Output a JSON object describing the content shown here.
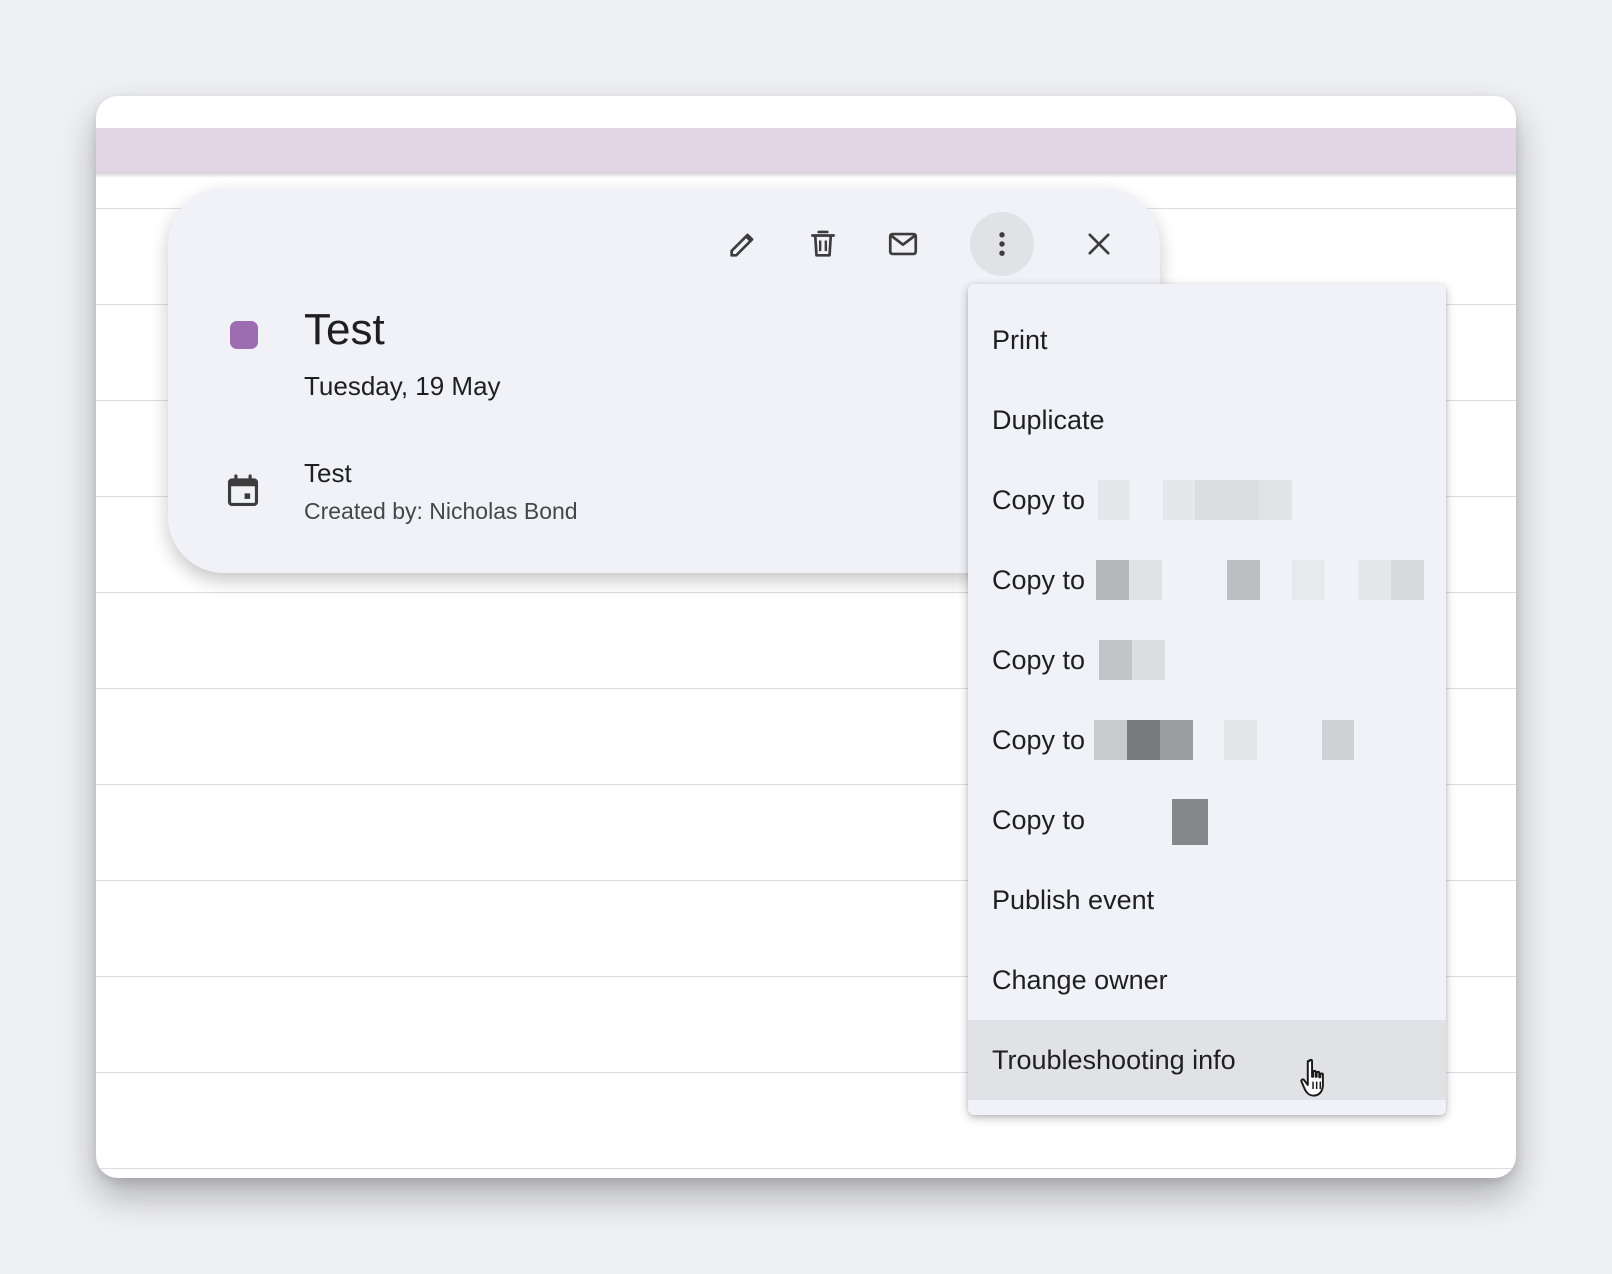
{
  "event": {
    "title": "Test",
    "date": "Tuesday, 19 May",
    "calendar": "Test",
    "created_by": "Created by: Nicholas Bond",
    "color": "#9c6db0"
  },
  "toolbar": {
    "edit_icon": "pencil-icon",
    "delete_icon": "trash-icon",
    "email_icon": "mail-icon",
    "more_icon": "more-vert-icon",
    "close_icon": "close-icon"
  },
  "menu": {
    "items": [
      {
        "label": "Print"
      },
      {
        "label": "Duplicate"
      },
      {
        "label": "Copy to"
      },
      {
        "label": "Copy to"
      },
      {
        "label": "Copy to"
      },
      {
        "label": "Copy to"
      },
      {
        "label": "Copy to"
      },
      {
        "label": "Publish event"
      },
      {
        "label": "Change owner"
      },
      {
        "label": "Troubleshooting info"
      }
    ],
    "hovered_index": 9
  },
  "colors": {
    "allday_band": "#e2d6e6",
    "card_bg": "#f0f2f8",
    "hover_bg": "#e1e2e6"
  }
}
